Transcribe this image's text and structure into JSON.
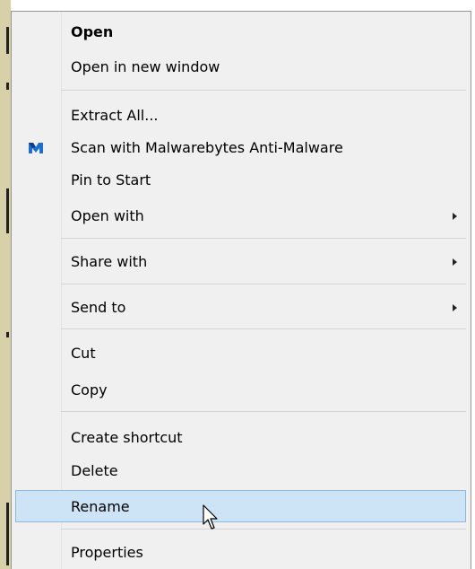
{
  "menu": {
    "items": [
      {
        "label": "Open",
        "bold": true
      },
      {
        "label": "Open in new window"
      },
      {
        "label": "Extract All..."
      },
      {
        "label": "Scan with Malwarebytes Anti-Malware",
        "icon": "malwarebytes-icon"
      },
      {
        "label": "Pin to Start"
      },
      {
        "label": "Open with",
        "submenu": true
      },
      {
        "label": "Share with",
        "submenu": true
      },
      {
        "label": "Send to",
        "submenu": true
      },
      {
        "label": "Cut"
      },
      {
        "label": "Copy"
      },
      {
        "label": "Create shortcut"
      },
      {
        "label": "Delete"
      },
      {
        "label": "Rename",
        "highlighted": true
      },
      {
        "label": "Properties"
      }
    ]
  },
  "colors": {
    "menu_background": "#f0f0f0",
    "highlight_background": "#cde4f7",
    "highlight_border": "#8eb8e0",
    "separator": "#d5d5d5",
    "malwarebytes_blue": "#1b6fd1"
  }
}
